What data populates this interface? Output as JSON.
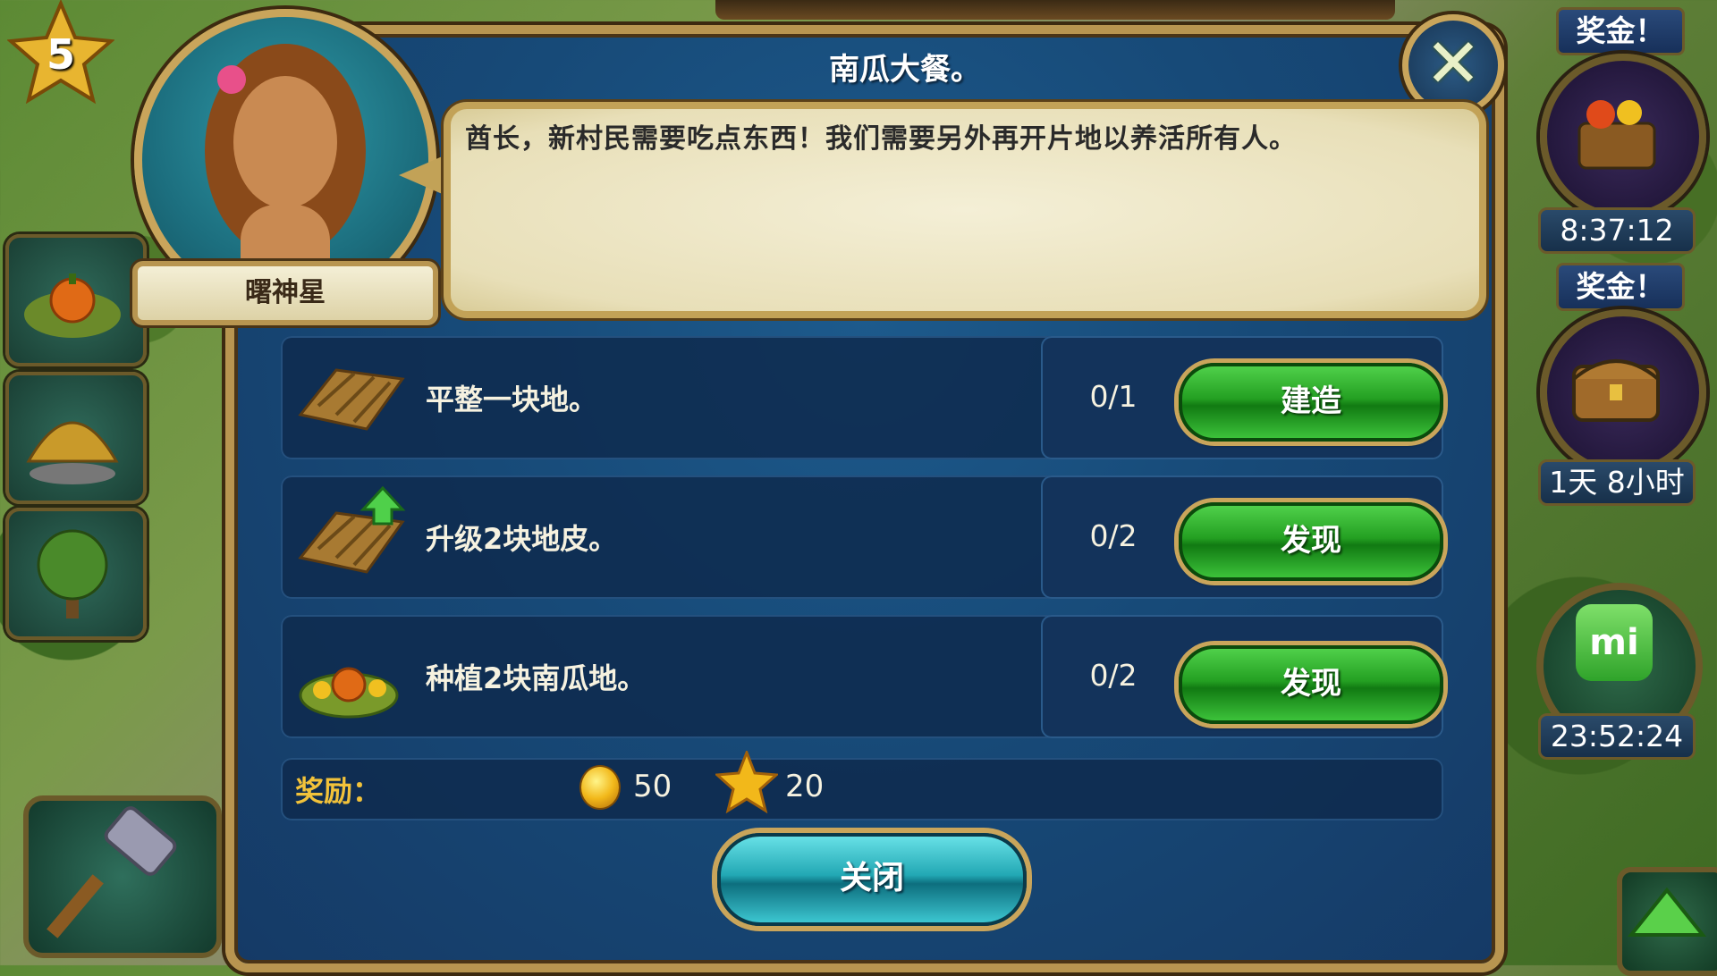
{
  "hud": {
    "level": "5",
    "right_panel": {
      "bonus_1": {
        "label": "奖金！",
        "timer": "8:37:12"
      },
      "bonus_2": {
        "label": "奖金！",
        "timer": "1天 8小时"
      },
      "mi": {
        "label": "mi",
        "timer": "23:52:24"
      }
    }
  },
  "dialog": {
    "title": "南瓜大餐。",
    "character_name": "曙神星",
    "speech": "酋长，新村民需要吃点东西！我们需要另外再开片地以养活所有人。",
    "tasks": [
      {
        "label": "平整一块地。",
        "progress": "0/1",
        "button": "建造",
        "icon": "farm-plot-icon"
      },
      {
        "label": "升级2块地皮。",
        "progress": "0/2",
        "button": "发现",
        "icon": "farm-plot-upgrade-icon"
      },
      {
        "label": "种植2块南瓜地。",
        "progress": "0/2",
        "button": "发现",
        "icon": "pumpkin-patch-icon"
      }
    ],
    "reward": {
      "label": "奖励：",
      "coins": "50",
      "xp": "20"
    },
    "close_label": "关闭"
  },
  "colors": {
    "dialog_bg": "#174a78",
    "gold_border": "#b89550",
    "green_button": "#24a022",
    "teal_button": "#22a8b4",
    "reward_label": "#f2c23a"
  }
}
